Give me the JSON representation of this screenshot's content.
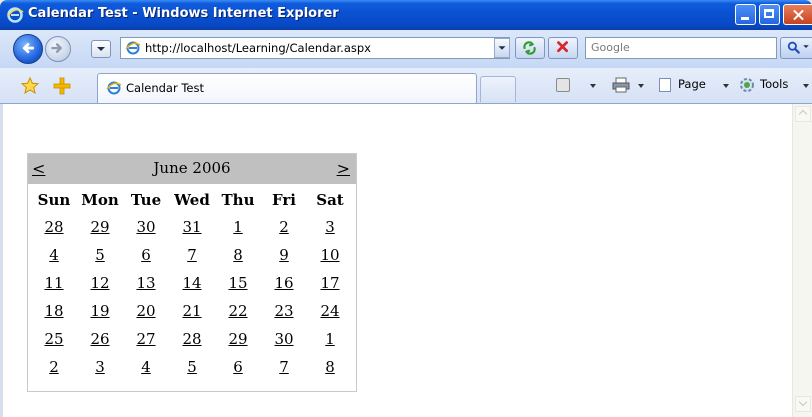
{
  "window": {
    "title": "Calendar Test - Windows Internet Explorer"
  },
  "address_bar": {
    "url": "http://localhost/Learning/Calendar.aspx"
  },
  "search": {
    "placeholder": "Google"
  },
  "tab": {
    "label": "Calendar Test"
  },
  "command_bar": {
    "page_label": "Page",
    "tools_label": "Tools"
  },
  "calendar": {
    "prev": "<",
    "next": ">",
    "month_label": "June 2006",
    "days_of_week": [
      "Sun",
      "Mon",
      "Tue",
      "Wed",
      "Thu",
      "Fri",
      "Sat"
    ],
    "weeks": [
      [
        "28",
        "29",
        "30",
        "31",
        "1",
        "2",
        "3"
      ],
      [
        "4",
        "5",
        "6",
        "7",
        "8",
        "9",
        "10"
      ],
      [
        "11",
        "12",
        "13",
        "14",
        "15",
        "16",
        "17"
      ],
      [
        "18",
        "19",
        "20",
        "21",
        "22",
        "23",
        "24"
      ],
      [
        "25",
        "26",
        "27",
        "28",
        "29",
        "30",
        "1"
      ],
      [
        "2",
        "3",
        "4",
        "5",
        "6",
        "7",
        "8"
      ]
    ]
  },
  "colors": {
    "title_bar": "#0A50D0",
    "calendar_header": "#C0C0C0"
  }
}
